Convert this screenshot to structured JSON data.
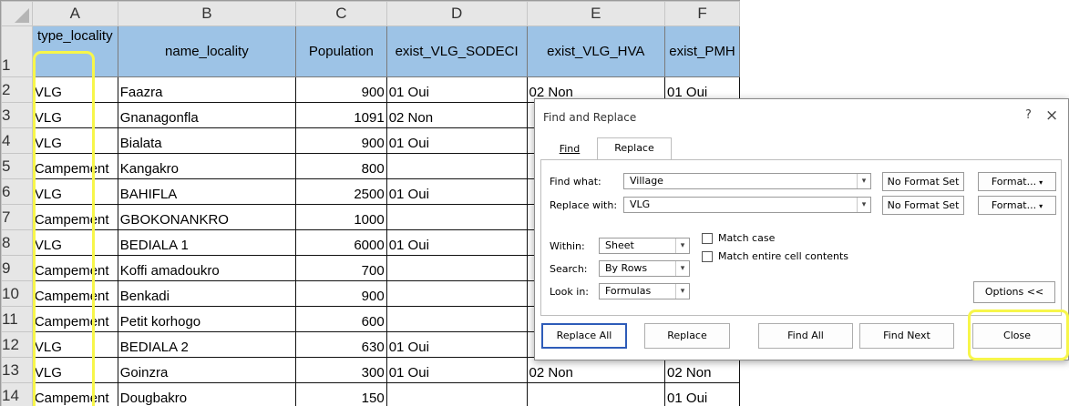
{
  "columns": [
    "A",
    "B",
    "C",
    "D",
    "E",
    "F"
  ],
  "header_row_number": "1",
  "headers": [
    "type_locality",
    "name_locality",
    "Population",
    "exist_VLG_SODECI",
    "exist_VLG_HVA",
    "exist_PMH"
  ],
  "rows": [
    {
      "n": "2",
      "a": "VLG",
      "b": "Faazra",
      "c": "900",
      "d": "01 Oui",
      "e": "02 Non",
      "f": "01 Oui"
    },
    {
      "n": "3",
      "a": "VLG",
      "b": "Gnanagonfla",
      "c": "1091",
      "d": "02 Non",
      "e": "",
      "f": ""
    },
    {
      "n": "4",
      "a": "VLG",
      "b": "Bialata",
      "c": "900",
      "d": "01 Oui",
      "e": "",
      "f": ""
    },
    {
      "n": "5",
      "a": "Campement",
      "b": "Kangakro",
      "c": "800",
      "d": "",
      "e": "",
      "f": ""
    },
    {
      "n": "6",
      "a": "VLG",
      "b": "BAHIFLA",
      "c": "2500",
      "d": "01 Oui",
      "e": "",
      "f": ""
    },
    {
      "n": "7",
      "a": "Campement",
      "b": "GBOKONANKRO",
      "c": "1000",
      "d": "",
      "e": "",
      "f": ""
    },
    {
      "n": "8",
      "a": "VLG",
      "b": "BEDIALA 1",
      "c": "6000",
      "d": "01 Oui",
      "e": "",
      "f": ""
    },
    {
      "n": "9",
      "a": "Campement",
      "b": "Koffi amadoukro",
      "c": "700",
      "d": "",
      "e": "",
      "f": ""
    },
    {
      "n": "10",
      "a": "Campement",
      "b": "Benkadi",
      "c": "900",
      "d": "",
      "e": "",
      "f": ""
    },
    {
      "n": "11",
      "a": "Campement",
      "b": "Petit korhogo",
      "c": "600",
      "d": "",
      "e": "",
      "f": ""
    },
    {
      "n": "12",
      "a": "VLG",
      "b": "BEDIALA 2",
      "c": "630",
      "d": "01 Oui",
      "e": "",
      "f": ""
    },
    {
      "n": "13",
      "a": "VLG",
      "b": "Goinzra",
      "c": "300",
      "d": "01 Oui",
      "e": "02 Non",
      "f": "02 Non"
    },
    {
      "n": "14",
      "a": "Campement",
      "b": "Dougbakro",
      "c": "150",
      "d": "",
      "e": "",
      "f": "01 Oui"
    }
  ],
  "dialog": {
    "title": "Find and Replace",
    "help": "?",
    "close_x": "×",
    "tab_find": "Find",
    "tab_replace": "Replace",
    "find_what_label": "Find what:",
    "find_what_value": "Village",
    "replace_with_label": "Replace with:",
    "replace_with_value": "VLG",
    "no_format_1": "No Format Set",
    "no_format_2": "No Format Set",
    "format_1": "Format...",
    "format_2": "Format...",
    "within_label": "Within:",
    "within_value": "Sheet",
    "search_label": "Search:",
    "search_value": "By Rows",
    "lookin_label": "Look in:",
    "lookin_value": "Formulas",
    "match_case": "Match case",
    "match_entire": "Match entire cell contents",
    "options": "Options <<",
    "replace_all": "Replace All",
    "replace": "Replace",
    "find_all": "Find All",
    "find_next": "Find Next",
    "close": "Close"
  },
  "colors": {
    "header_fill": "#9dc3e6",
    "highlight": "#f7f64a",
    "default_button_border": "#2d5bb8"
  }
}
